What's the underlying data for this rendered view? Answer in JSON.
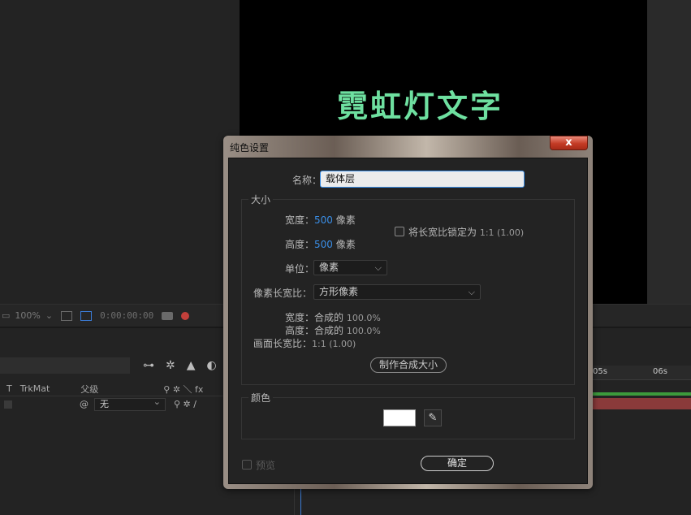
{
  "composition": {
    "text": "霓虹灯文字"
  },
  "viewer_bar": {
    "zoom": "100%",
    "timecode": "0:00:00:00"
  },
  "timeline": {
    "columns": {
      "t": "T",
      "trkmat": "TrkMat",
      "parent": "父级"
    },
    "layer": {
      "parent_value": "无"
    },
    "ruler": {
      "mark_a": "05s",
      "mark_b": "06s"
    }
  },
  "dialog": {
    "title": "纯色设置",
    "close_label": "x",
    "name_label": "名称：",
    "name_value": "载体层",
    "size": {
      "title": "大小",
      "width_label": "宽度：",
      "width_value": "500",
      "width_unit": "像素",
      "height_label": "高度：",
      "height_value": "500",
      "height_unit": "像素",
      "lock_label": "将长宽比锁定为",
      "lock_ratio": "1:1 (1.00)",
      "units_label": "单位：",
      "units_value": "像素",
      "par_label": "像素长宽比：",
      "par_value": "方形像素",
      "comp_width_label": "宽度：合成的",
      "comp_width_value": "100.0%",
      "comp_height_label": "高度：合成的",
      "comp_height_value": "100.0%",
      "frame_ratio_label": "画面长宽比：",
      "frame_ratio_value": "1:1 (1.00)",
      "make_comp_size": "制作合成大小"
    },
    "color": {
      "title": "颜色",
      "value": "#ffffff"
    },
    "preview_label": "预览",
    "ok_label": "确定"
  }
}
